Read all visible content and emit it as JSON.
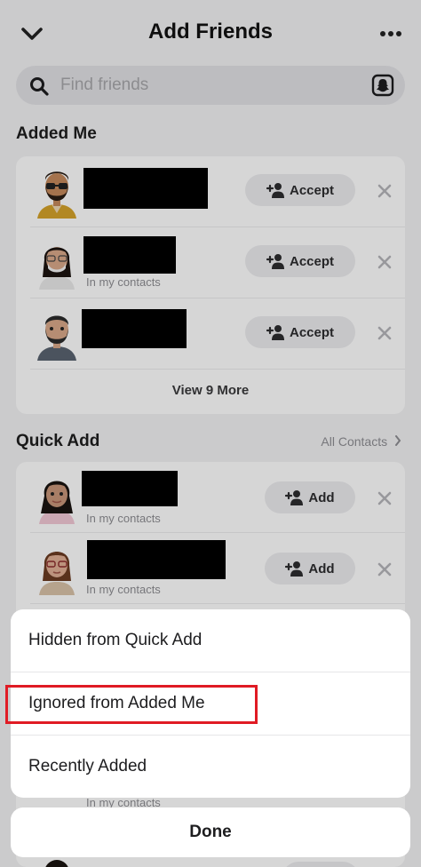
{
  "header": {
    "title": "Add Friends"
  },
  "search": {
    "placeholder": "Find friends"
  },
  "added_me": {
    "title": "Added Me",
    "accept_label": "Accept",
    "rows": [
      {
        "subtitle": ""
      },
      {
        "subtitle": "In my contacts"
      },
      {
        "subtitle": ""
      }
    ],
    "view_more": "View 9 More"
  },
  "quick_add": {
    "title": "Quick Add",
    "link": "All Contacts",
    "add_label": "Add",
    "rows": [
      {
        "subtitle": "In my contacts"
      },
      {
        "subtitle": "In my contacts"
      },
      {
        "subtitle": "In my contacts"
      }
    ]
  },
  "sheet": {
    "options": [
      {
        "label": "Hidden from Quick Add"
      },
      {
        "label": "Ignored from Added Me"
      },
      {
        "label": "Recently Added"
      }
    ],
    "done_label": "Done"
  },
  "colors": {
    "highlight": "#e01b24",
    "background": "#f2f2f4"
  },
  "icons": [
    "chevron-down-icon",
    "more-icon",
    "search-icon",
    "snapcode-icon",
    "add-friend-icon",
    "close-icon",
    "chevron-right-icon"
  ]
}
